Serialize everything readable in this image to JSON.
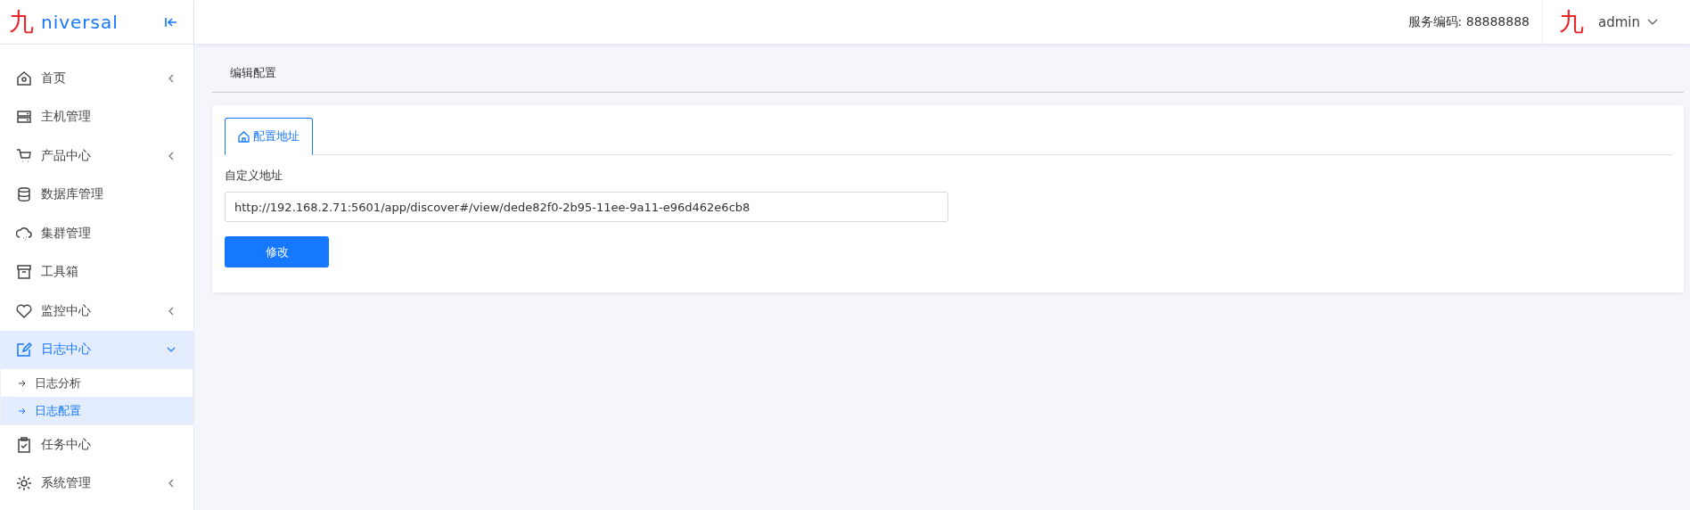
{
  "logo": {
    "mark": "九",
    "text": "niversal"
  },
  "header": {
    "service_code": "服务编码: 88888888",
    "avatar_mark": "九",
    "user": "admin"
  },
  "sidebar": {
    "items": [
      {
        "label": "首页",
        "expanded": false,
        "selected": false
      },
      {
        "label": "主机管理",
        "selected": false
      },
      {
        "label": "产品中心",
        "expanded": false,
        "selected": false
      },
      {
        "label": "数据库管理",
        "selected": false
      },
      {
        "label": "集群管理",
        "selected": false
      },
      {
        "label": "工具箱",
        "selected": false
      },
      {
        "label": "监控中心",
        "expanded": false,
        "selected": false
      },
      {
        "label": "日志中心",
        "expanded": true,
        "selected": true,
        "children": [
          {
            "label": "日志分析",
            "selected": false
          },
          {
            "label": "日志配置",
            "selected": true
          }
        ]
      },
      {
        "label": "任务中心",
        "selected": false
      },
      {
        "label": "系统管理",
        "expanded": false,
        "selected": false
      }
    ]
  },
  "page_title": "编辑配置",
  "tabs": [
    {
      "label": "配置地址",
      "selected": true
    }
  ],
  "form": {
    "label": "自定义地址",
    "value": "http://192.168.2.71:5601/app/discover#/view/dede82f0-2b95-11ee-9a11-e96d462e6cb8",
    "button": "修改"
  }
}
